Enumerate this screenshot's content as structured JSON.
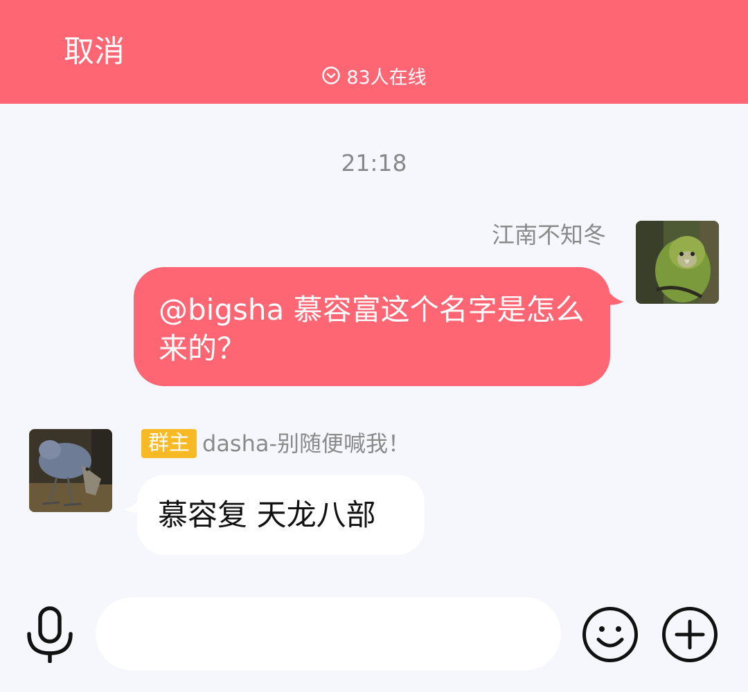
{
  "header": {
    "cancel_label": "取消",
    "online_text": "83人在线",
    "online_icon": "chevron-down-circle-icon",
    "background_color": "#ff6673"
  },
  "messages": [
    {
      "type": "timestamp",
      "text": "21:18"
    },
    {
      "type": "outgoing",
      "sender": "江南不知冬",
      "text": "@bigsha 慕容富这个名字是怎么来的？",
      "bubble_color": "#ff6673"
    },
    {
      "type": "incoming",
      "badge": "群主",
      "sender": "dasha-别随便喊我！",
      "text": "慕容复 天龙八部",
      "badge_color": "#f7b924",
      "bubble_color": "#ffffff"
    }
  ],
  "input_bar": {
    "mic_icon": "microphone-icon",
    "input_value": "",
    "emoji_icon": "smiley-icon",
    "plus_icon": "plus-circle-icon"
  }
}
